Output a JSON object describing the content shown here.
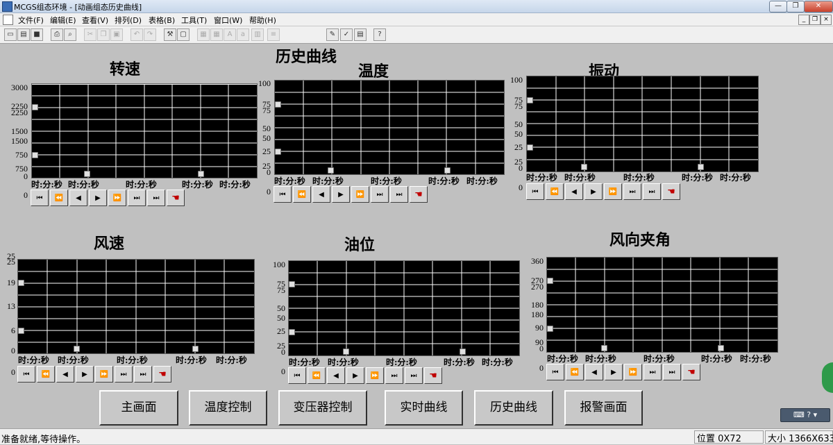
{
  "window": {
    "title": "MCGS组态环境 - [动画组态历史曲线]",
    "controls": [
      "—",
      "❐",
      "✕"
    ]
  },
  "menu": {
    "items": [
      "文件(F)",
      "编辑(E)",
      "查看(V)",
      "排列(D)",
      "表格(B)",
      "工具(T)",
      "窗口(W)",
      "帮助(H)"
    ],
    "mdi_controls": [
      "_",
      "❐",
      "×"
    ]
  },
  "toolbar": {
    "icons": [
      "new-window-icon",
      "open-icon",
      "save-icon",
      "print-icon",
      "print-preview-icon",
      "cut-icon",
      "copy-icon",
      "paste-icon",
      "undo-icon",
      "redo-icon",
      "tools-icon",
      "window-icon",
      "align-left-icon",
      "align-center-icon",
      "font-icon",
      "text-size-icon",
      "grid-icon",
      "list-icon",
      "properties-icon",
      "check-icon",
      "table-icon",
      "help-icon"
    ]
  },
  "canvas": {
    "main_title": "历史曲线",
    "charts": [
      {
        "title": "转速",
        "y_labels": [
          "3000",
          "2250",
          "2250",
          "1500",
          "1500",
          "750",
          "750",
          "0",
          "0"
        ],
        "time_labels": [
          "时:分:秒",
          "时:分:秒",
          "时:分:秒",
          "时:分:秒",
          "时:分:秒"
        ]
      },
      {
        "title": "温度",
        "y_labels": [
          "100",
          "75",
          "75",
          "50",
          "50",
          "25",
          "25",
          "0",
          "0"
        ],
        "time_labels": [
          "时:分:秒",
          "时:分:秒",
          "时:分:秒",
          "时:分:秒",
          "时:分:秒"
        ]
      },
      {
        "title": "振动",
        "y_labels": [
          "100",
          "75",
          "75",
          "50",
          "50",
          "25",
          "25",
          "0",
          "0"
        ],
        "time_labels": [
          "时:分:秒",
          "时:分:秒",
          "时:分:秒",
          "时:分:秒",
          "时:分:秒"
        ]
      },
      {
        "title": "风速",
        "y_labels": [
          "25",
          "25",
          "19",
          "13",
          "6",
          "0",
          "0"
        ],
        "time_labels": [
          "时:分:秒",
          "时:分:秒",
          "时:分:秒",
          "时:分:秒",
          "时:分:秒"
        ]
      },
      {
        "title": "油位",
        "y_labels": [
          "100",
          "75",
          "75",
          "50",
          "50",
          "25",
          "25",
          "0",
          "0"
        ],
        "time_labels": [
          "时:分:秒",
          "时:分:秒",
          "时:分:秒",
          "时:分:秒",
          "时:分:秒"
        ]
      },
      {
        "title": "风向夹角",
        "y_labels": [
          "360",
          "270",
          "270",
          "180",
          "180",
          "90",
          "90",
          "0",
          "0"
        ],
        "time_labels": [
          "时:分:秒",
          "时:分:秒",
          "时:分:秒",
          "时:分:秒",
          "时:分:秒"
        ]
      }
    ],
    "controls": [
      "first-icon",
      "rewind-icon",
      "step-back-icon",
      "play-icon",
      "fast-forward-icon",
      "last-icon",
      "end-icon",
      "hand-icon"
    ],
    "nav_buttons": [
      "主画面",
      "温度控制",
      "变压器控制",
      "实时曲线",
      "历史曲线",
      "报警画面"
    ]
  },
  "status": {
    "message": "准备就绪,等待操作。",
    "position": "位置 0X72",
    "size": "大小 1366X633"
  },
  "colors": {
    "plot_bg": "#000000",
    "grid": "#ffffff",
    "canvas_bg": "#c0c0c0",
    "hand_red": "#c00000"
  }
}
